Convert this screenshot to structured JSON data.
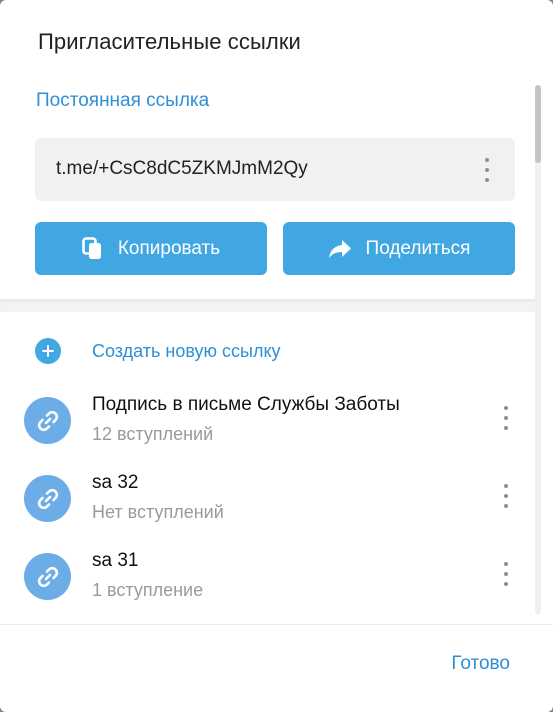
{
  "dialog": {
    "title": "Пригласительные ссылки"
  },
  "permanent": {
    "heading": "Постоянная ссылка",
    "link": "t.me/+CsC8dC5ZKMJmM2Qy",
    "menu_icon": "more-vertical-icon"
  },
  "actions": {
    "copy_label": "Копировать",
    "copy_icon": "copy-icon",
    "share_label": "Поделиться",
    "share_icon": "share-icon"
  },
  "create": {
    "label": "Создать новую ссылку",
    "icon": "plus-circle-icon"
  },
  "links": [
    {
      "title": "Подпись в письме Службы Заботы",
      "subtitle": "12 вступлений",
      "icon": "link-icon"
    },
    {
      "title": "sa 32",
      "subtitle": "Нет вступлений",
      "icon": "link-icon"
    },
    {
      "title": "sa 31",
      "subtitle": "1 вступление",
      "icon": "link-icon"
    }
  ],
  "footer": {
    "done_label": "Готово"
  },
  "colors": {
    "accent": "#40a7e3",
    "accent_text": "#2d8fd5",
    "avatar": "#6cade7"
  }
}
